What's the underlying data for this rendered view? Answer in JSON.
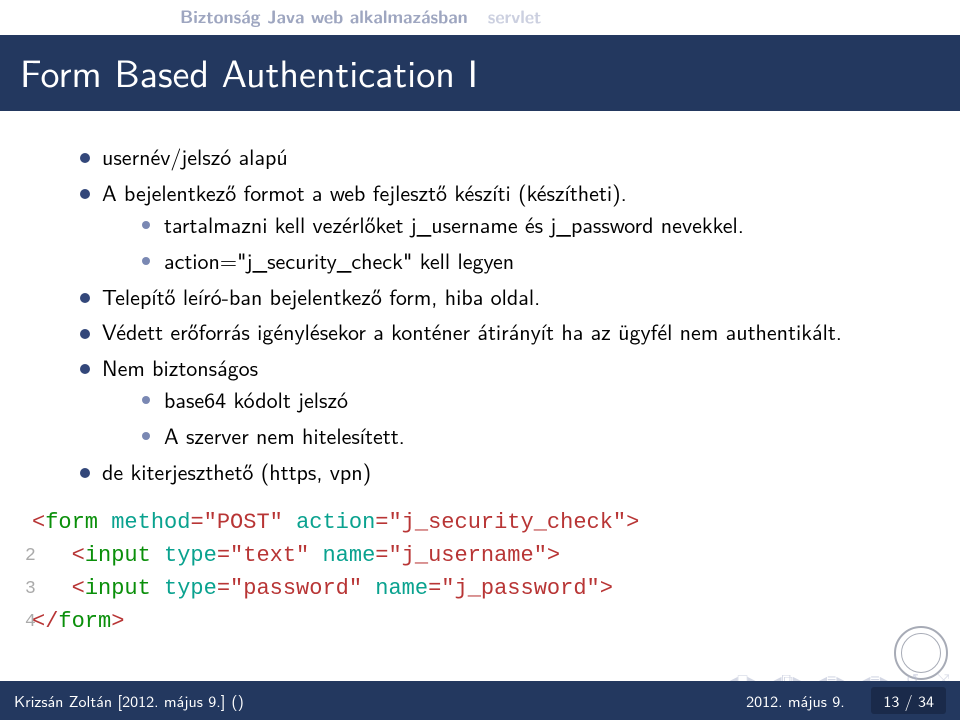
{
  "nav": {
    "tab1": "Biztonság Java web alkalmazásban",
    "tab2": "servlet"
  },
  "title": "Form Based Authentication I",
  "bullets": {
    "b1": "usernév/jelszó alapú",
    "b2": "A bejelentkező formot a web fejlesztő készíti (készítheti).",
    "b2a": "tartalmazni kell vezérlőket j_username és j_password nevekkel.",
    "b2b": "action=\"j_security_check\" kell legyen",
    "b3": "Telepítő leíró-ban bejelentkező form, hiba oldal.",
    "b4": "Védett erőforrás igénylésekor a konténer átirányít ha az ügyfél nem authentikált.",
    "b5": "Nem biztonságos",
    "b5a": "base64 kódolt jelszó",
    "b5b": "A szerver nem hitelesített.",
    "b6": "de kiterjeszthető (https, vpn)"
  },
  "code": {
    "ln2": "2",
    "ln3": "3",
    "ln4": "4",
    "form": "form",
    "input": "input",
    "method_attr": "method",
    "method_val": "\"POST\"",
    "action_attr": "action",
    "action_val": "\"j_security_check\"",
    "type_attr": "type",
    "type_text": "\"text\"",
    "type_pass": "\"password\"",
    "name_attr": "name",
    "name_user": "\"j_username\"",
    "name_pass": "\"j_password\""
  },
  "footer": {
    "author": "Krizsán Zoltán [2012. május 9.]",
    "empty_parens": "()",
    "date": "2012. május 9.",
    "page": "13 / 34"
  }
}
